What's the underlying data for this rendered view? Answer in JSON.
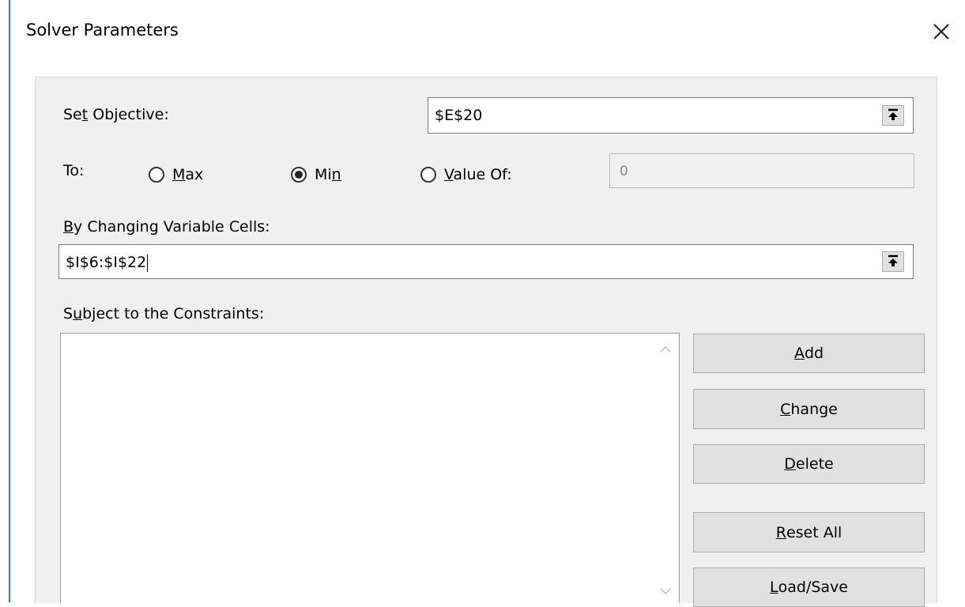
{
  "window": {
    "title": "Solver Parameters",
    "close_icon": "close-icon"
  },
  "objective": {
    "label_pre": "Se",
    "label_key": "t",
    "label_post": " Objective:",
    "value": "$E$20"
  },
  "to": {
    "label": "To:",
    "max": {
      "key": "M",
      "rest": "ax",
      "checked": false
    },
    "min": {
      "pre": "Mi",
      "key": "n",
      "checked": true
    },
    "value_of": {
      "key": "V",
      "rest": "alue Of:",
      "checked": false
    },
    "value": "0"
  },
  "variables": {
    "label_key": "B",
    "label_rest": "y Changing Variable Cells:",
    "value": "$I$6:$I$22"
  },
  "constraints": {
    "label_pre": "S",
    "label_key": "u",
    "label_post": "bject to the Constraints:",
    "items": []
  },
  "buttons": {
    "add": {
      "key": "A",
      "rest": "dd"
    },
    "change": {
      "key": "C",
      "rest": "hange"
    },
    "delete": {
      "key": "D",
      "rest": "elete"
    },
    "reset": {
      "key": "R",
      "rest": "eset All"
    },
    "load": {
      "key": "L",
      "rest": "oad/Save"
    }
  },
  "colors": {
    "window_border": "#2b79d0",
    "panel_bg": "#f0f0f0",
    "button_bg": "#e1e1e1"
  }
}
